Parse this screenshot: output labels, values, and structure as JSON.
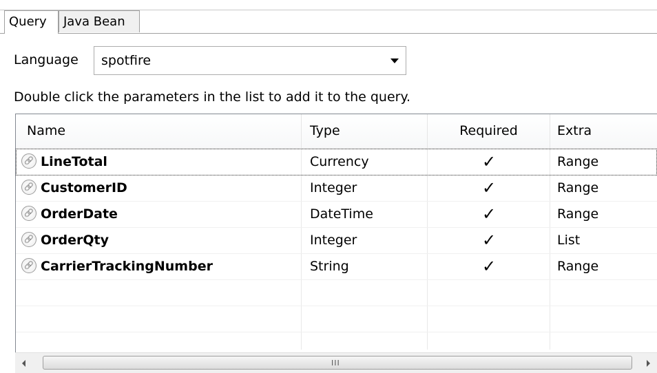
{
  "tabs": [
    {
      "label": "Query",
      "active": true
    },
    {
      "label": "Java Bean",
      "active": false
    }
  ],
  "language": {
    "label": "Language",
    "selected": "spotfire"
  },
  "hint": "Double click the parameters in the list to add it to the query.",
  "table": {
    "columns": [
      "Name",
      "Type",
      "Required",
      "Extra"
    ],
    "rows": [
      {
        "name": "LineTotal",
        "type": "Currency",
        "required": "✓",
        "extra": "Range"
      },
      {
        "name": "CustomerID",
        "type": "Integer",
        "required": "✓",
        "extra": "Range"
      },
      {
        "name": "OrderDate",
        "type": "DateTime",
        "required": "✓",
        "extra": "Range"
      },
      {
        "name": "OrderQty",
        "type": "Integer",
        "required": "✓",
        "extra": "List"
      },
      {
        "name": "CarrierTrackingNumber",
        "type": "String",
        "required": "✓",
        "extra": "Range"
      }
    ]
  },
  "scrollbar": {
    "grip": "III"
  }
}
